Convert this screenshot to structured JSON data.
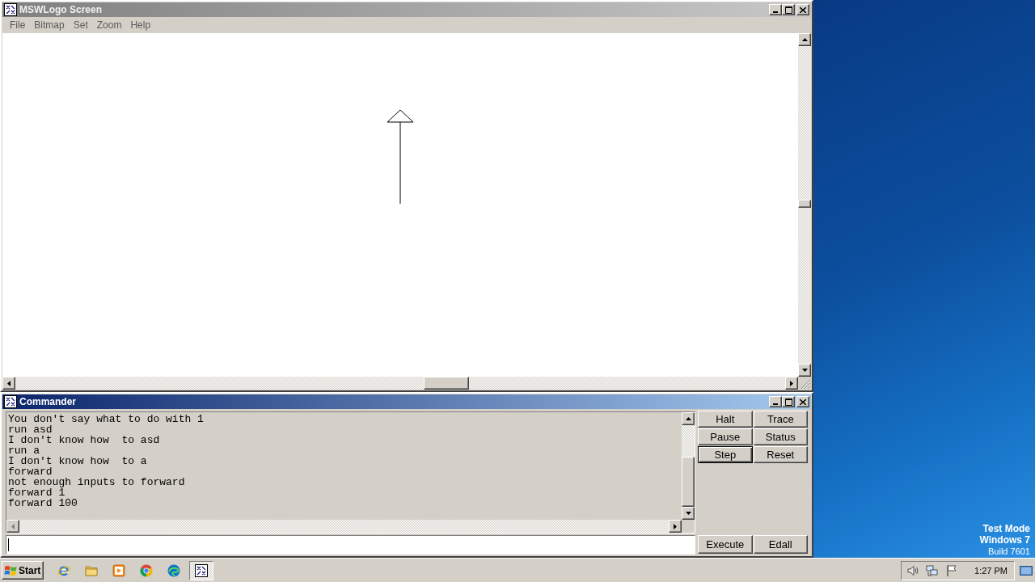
{
  "screen_window": {
    "title": "MSWLogo Screen",
    "active": false,
    "menu": [
      "File",
      "Bitmap",
      "Set",
      "Zoom",
      "Help"
    ]
  },
  "commander": {
    "title": "Commander",
    "active": true,
    "output_lines": [
      "You don't say what to do with 1",
      "run asd",
      "I don't know how  to asd",
      "run a",
      "I don't know how  to a",
      "forward",
      "not enough inputs to forward",
      "forward 1",
      "forward 100"
    ],
    "buttons": [
      {
        "label": "Halt",
        "default": false
      },
      {
        "label": "Trace",
        "default": false
      },
      {
        "label": "Pause",
        "default": false
      },
      {
        "label": "Status",
        "default": false
      },
      {
        "label": "Step",
        "default": true
      },
      {
        "label": "Reset",
        "default": false
      }
    ],
    "bottom_buttons": [
      "Execute",
      "Edall"
    ]
  },
  "desktop": {
    "notice_lines": [
      "Test Mode",
      "Windows 7",
      "Build 7601"
    ]
  },
  "taskbar": {
    "start_button": "Start",
    "task_buttons": [
      {
        "selected": true
      }
    ],
    "clock": "1:27 PM"
  }
}
